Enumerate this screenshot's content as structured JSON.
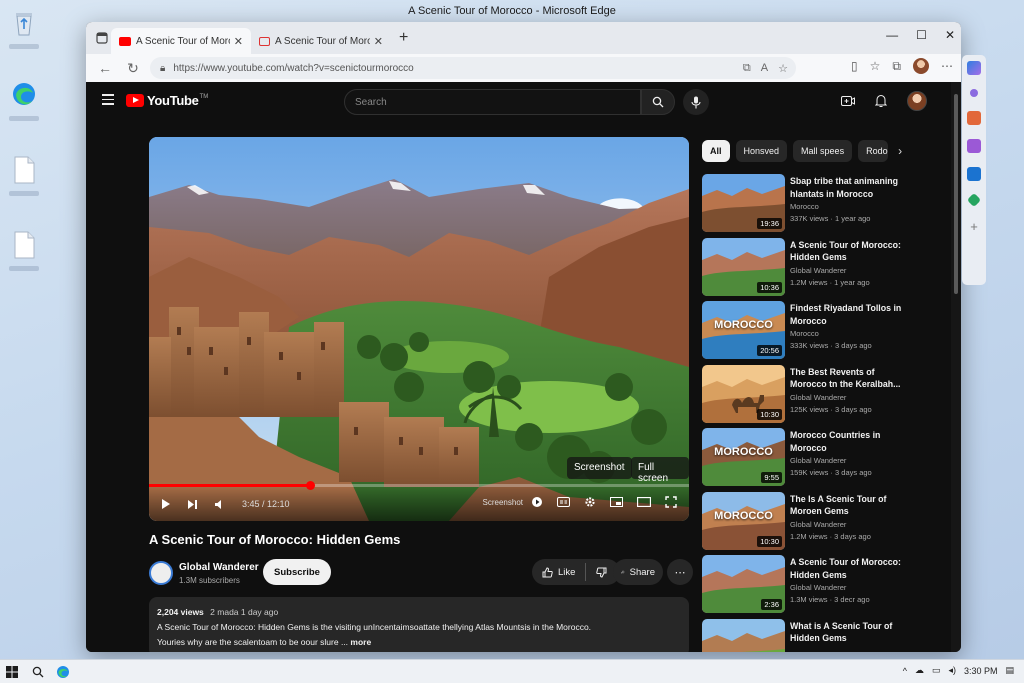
{
  "window": {
    "title": "A Scenic Tour of Morocco - Microsoft Edge"
  },
  "desktop": {
    "icons": [
      "recycle-bin-icon",
      "edge-icon",
      "file-icon",
      "file-icon"
    ]
  },
  "browser": {
    "tabs": [
      {
        "label": "A Scenic Tour of Morocco",
        "active": true
      },
      {
        "label": "A Scenic Tour of Morocco",
        "active": false
      }
    ],
    "url": "https://www.youtube.com/watch?v=scenictourmorocco"
  },
  "youtube": {
    "logo_text": "YouTube",
    "logo_tm": "TM",
    "search_placeholder": "Search",
    "player": {
      "overlay_buttons": [
        "Screenshot",
        "Full screen"
      ],
      "time": "3:45 / 12:10",
      "progress": 0.3,
      "screenshot_label": "Screenshot"
    },
    "video": {
      "title": "A Scenic Tour of Morocco: Hidden Gems",
      "channel": "Global Wanderer",
      "subscribers": "1.3M subscribers",
      "subscribe_label": "Subscribe",
      "like_label": "Like",
      "share_label": "Share",
      "views": "2,204 views",
      "date": "2 mada  1 day ago",
      "description_line1": "A Scenic Tour of Morocco: Hidden Gems is the visiting unIncentaimsoattate thellying Atlas Mountsis in the Morocco.",
      "description_line2": "Youries why are the scalentoam to be oour slure ...",
      "more_label": "more"
    },
    "chips": [
      "All",
      "Honsved",
      "Mall spees",
      "Rodon"
    ],
    "recommendations": [
      {
        "title": "Sbap tribe that animaning hlantats in Morocco",
        "channel": "Morocco",
        "meta": "337K views · 1 year ago",
        "duration": "19:36",
        "thumb_text": ""
      },
      {
        "title": "A Scenic Tour of Morocco: Hidden Gems",
        "channel": "Global Wanderer",
        "meta": "1.2M views · 1 year ago",
        "duration": "10:36",
        "thumb_text": ""
      },
      {
        "title": "Findest Riyadand Tollos in Morocco",
        "channel": "Morocco",
        "meta": "333K views · 3 days ago",
        "duration": "20:56",
        "thumb_text": "MOROCCO"
      },
      {
        "title": "The Best Revents of Morocco tn the Keralbah...",
        "channel": "Global Wanderer",
        "meta": "125K views · 3 days ago",
        "duration": "10:30",
        "thumb_text": ""
      },
      {
        "title": "Morocco Countries in Morocco",
        "channel": "Global Wanderer",
        "meta": "159K views · 3 days ago",
        "duration": "9:55",
        "thumb_text": "MOROCCO"
      },
      {
        "title": "The Is A Scenic Tour of Moroen Gems",
        "channel": "Global Wanderer",
        "meta": "1.2M views · 3 days ago",
        "duration": "10:30",
        "thumb_text": "MOROCCO"
      },
      {
        "title": "A Scenic Tour of Morocco: Hidden Gems",
        "channel": "Global Wanderer",
        "meta": "1.3M views · 3 decr ago",
        "duration": "2:36",
        "thumb_text": ""
      },
      {
        "title": "What is A Scenic Tour of Hidden Gems",
        "channel": "",
        "meta": "",
        "duration": "",
        "thumb_text": ""
      }
    ]
  },
  "taskbar": {
    "time": "3:30 PM"
  },
  "colors": {
    "accent": "#ff0000",
    "page_bg": "#0f0f0f",
    "chip_bg": "#272727"
  }
}
